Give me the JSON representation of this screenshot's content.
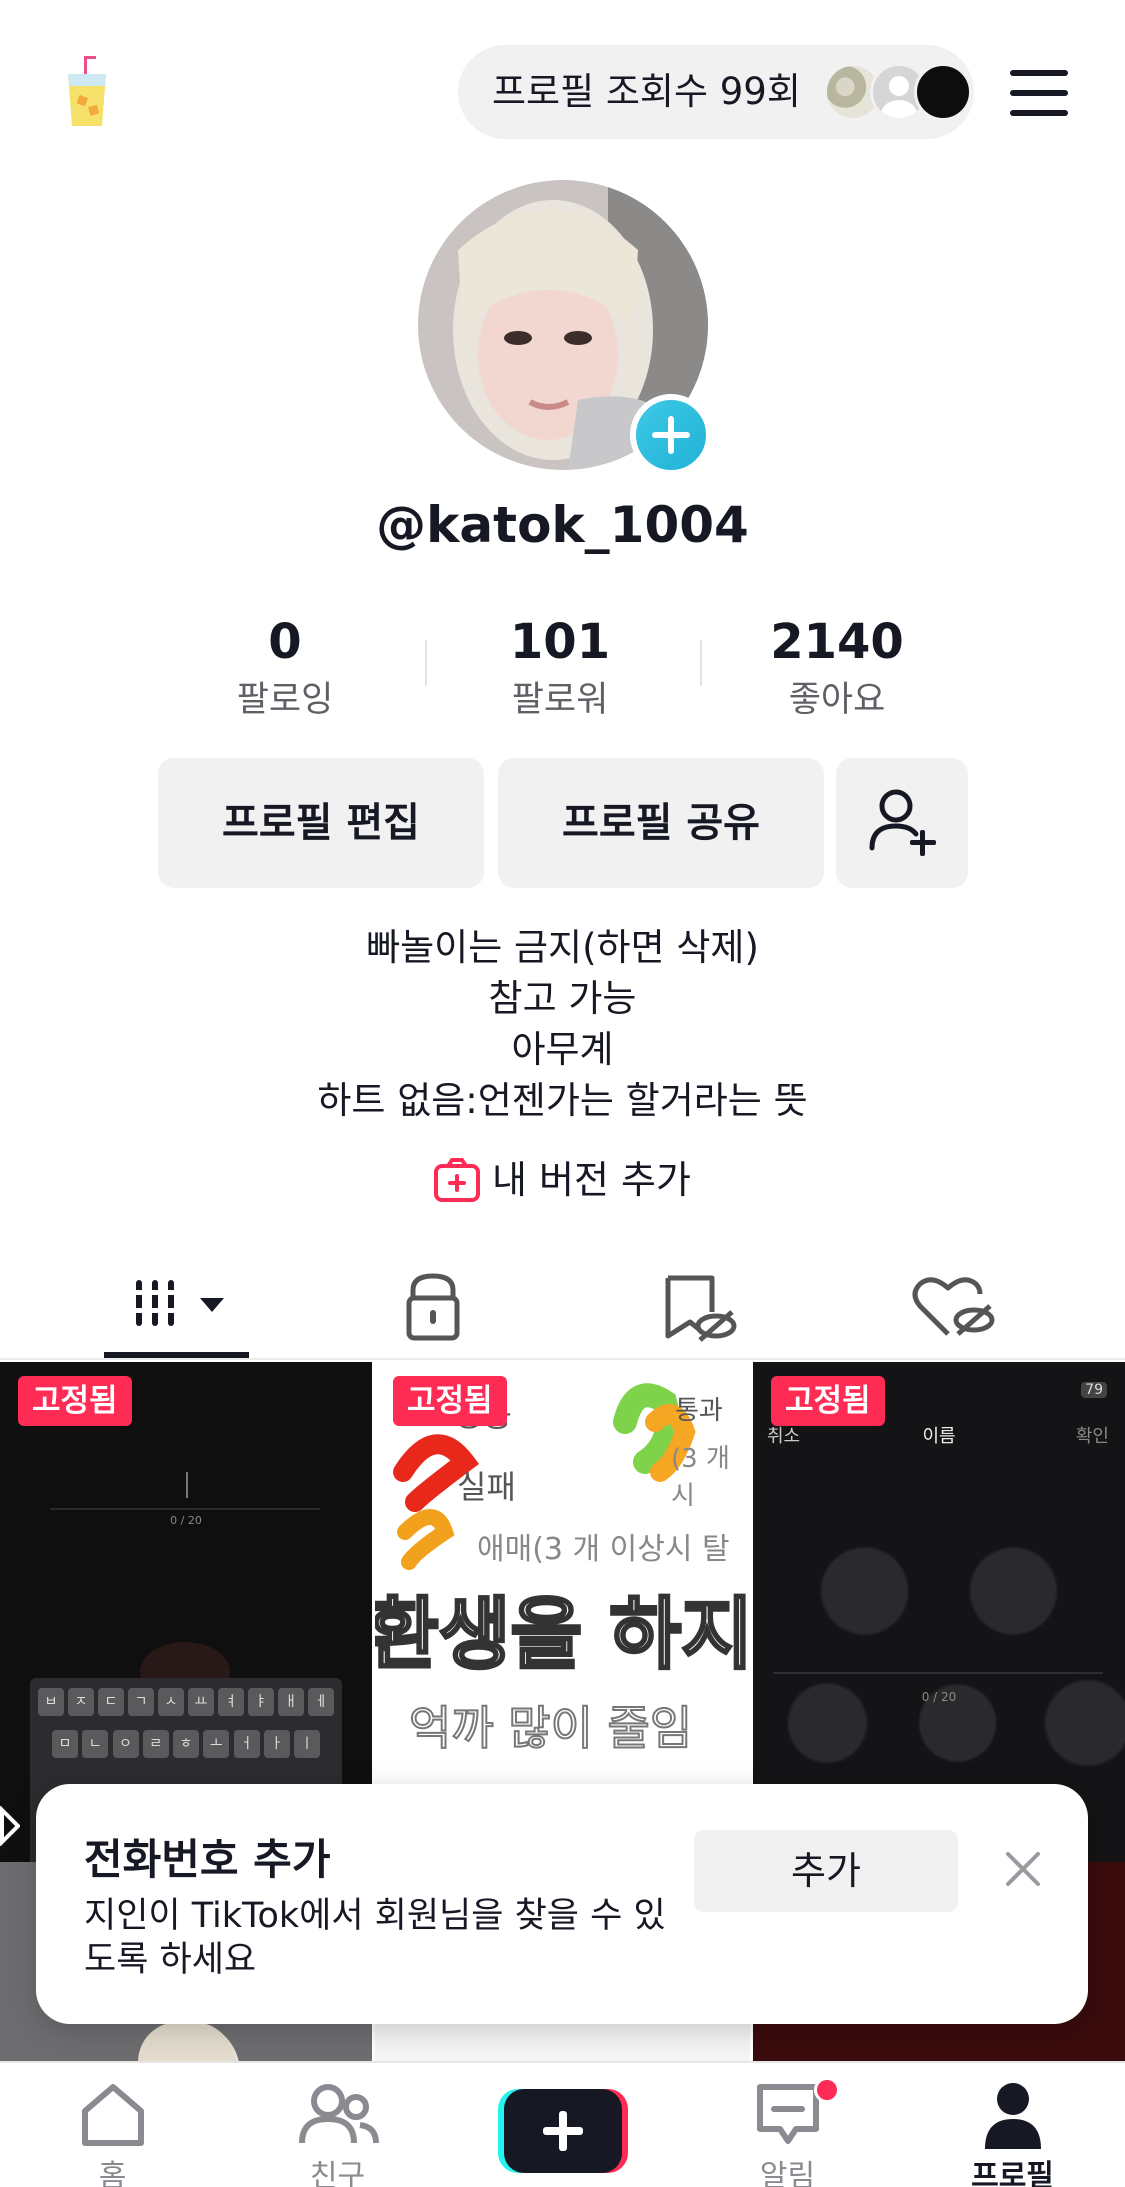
{
  "header": {
    "views_text": "프로필 조회수 99회"
  },
  "profile": {
    "username": "@katok_1004",
    "stats": [
      {
        "value": "0",
        "label": "팔로잉"
      },
      {
        "value": "101",
        "label": "팔로워"
      },
      {
        "value": "2140",
        "label": "좋아요"
      }
    ],
    "buttons": {
      "edit": "프로필 편집",
      "share": "프로필 공유"
    },
    "bio": [
      "빠놀이는 금지(하면 삭제)",
      "참고 가능",
      "아무계",
      "하트 없음:언젠가는 할거라는 뜻"
    ],
    "add_version": "내 버전 추가"
  },
  "tabs": [
    "videos-icon",
    "lock-icon",
    "saved-icon",
    "liked-icon"
  ],
  "grid": {
    "pinned_label": "고정됨",
    "c1": {
      "counter": "0 / 20",
      "keys_row1": [
        "ㅂ",
        "ㅈ",
        "ㄷ",
        "ㄱ",
        "ㅅ",
        "ㅛ",
        "ㅕ",
        "ㅑ",
        "ㅐ",
        "ㅔ"
      ],
      "keys_row2": [
        "ㅁ",
        "ㄴ",
        "ㅇ",
        "ㄹ",
        "ㅎ",
        "ㅗ",
        "ㅓ",
        "ㅏ",
        "ㅣ"
      ]
    },
    "c2": {
      "line1": "성공",
      "line1b": "통과",
      "line1c": "(3 개시",
      "line2": "실패",
      "line3": "애매(3 개 이상시 탈",
      "big": "환생을 하지",
      "sub": "억까 많이 줄임"
    },
    "c3": {
      "status": "79",
      "cancel": "취소",
      "title": "이름",
      "confirm": "확인",
      "counter": "0 / 20"
    }
  },
  "popup": {
    "title": "전화번호 추가",
    "description": "지인이 TikTok에서 회원님을 찾을 수 있도록 하세요",
    "add_button": "추가"
  },
  "nav": {
    "items": [
      {
        "label": "홈",
        "icon": "home-icon"
      },
      {
        "label": "친구",
        "icon": "friends-icon"
      },
      {
        "label": "",
        "icon": "create-icon"
      },
      {
        "label": "알림",
        "icon": "inbox-icon"
      },
      {
        "label": "프로필",
        "icon": "profile-icon"
      }
    ]
  },
  "colors": {
    "accent": "#fe2c55",
    "cyan": "#25f4ee",
    "text": "#161823",
    "secondary_bg": "#f1f1f2"
  }
}
